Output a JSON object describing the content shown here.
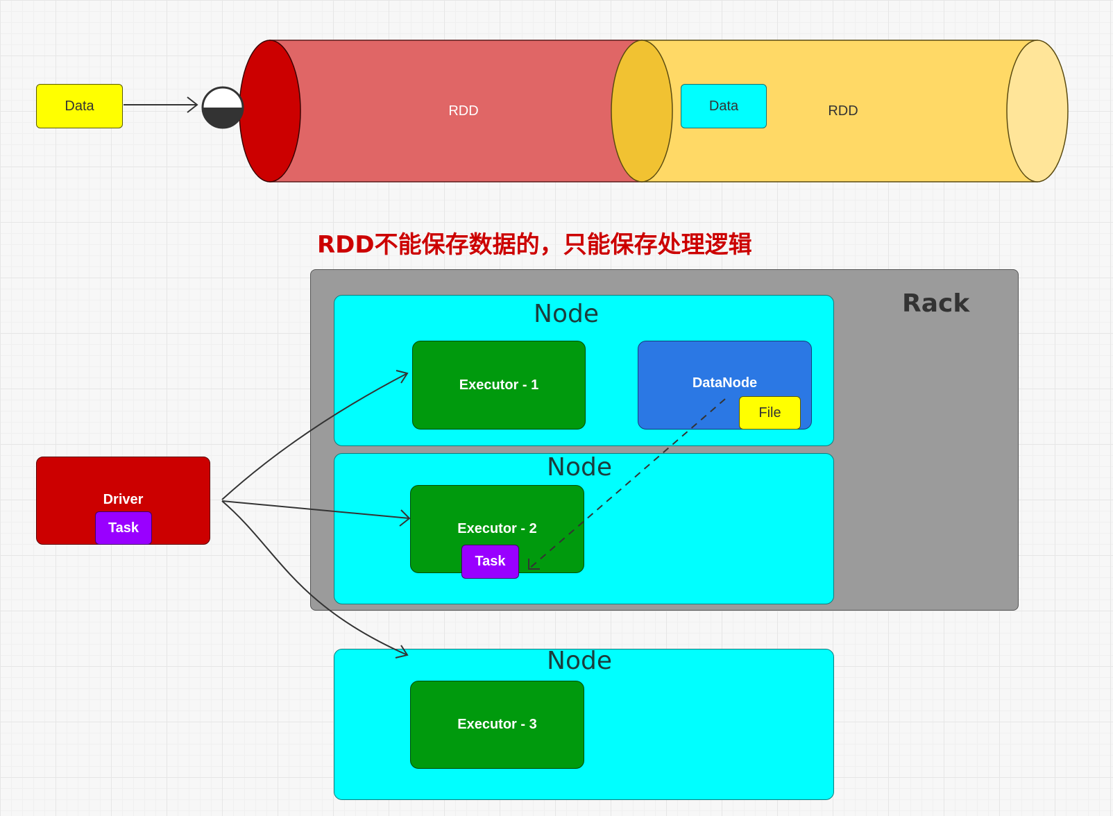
{
  "top": {
    "data_input_label": "Data",
    "rdd_left_label": "RDD",
    "rdd_right_label": "RDD",
    "data_inside_label": "Data"
  },
  "heading": "RDD不能保存数据的，只能保存处理逻辑",
  "rack": {
    "label": "Rack"
  },
  "nodes": [
    {
      "label": "Node",
      "executor": "Executor - 1",
      "datanode": "DataNode",
      "file": "File"
    },
    {
      "label": "Node",
      "executor": "Executor - 2",
      "task": "Task"
    },
    {
      "label": "Node",
      "executor": "Executor - 3"
    }
  ],
  "driver": {
    "label": "Driver",
    "task": "Task"
  },
  "colors": {
    "rdd_red": "#e06666",
    "rdd_red_cap": "#cc0000",
    "rdd_yellow": "#ffd966",
    "rdd_yellow_cap": "#f1c232",
    "node_cyan": "#00ffff",
    "executor_green": "#009a0d",
    "datanode_blue": "#2b78e4",
    "task_purple": "#9900ff",
    "driver_red": "#cc0000",
    "rack_gray": "#9b9b9b"
  }
}
